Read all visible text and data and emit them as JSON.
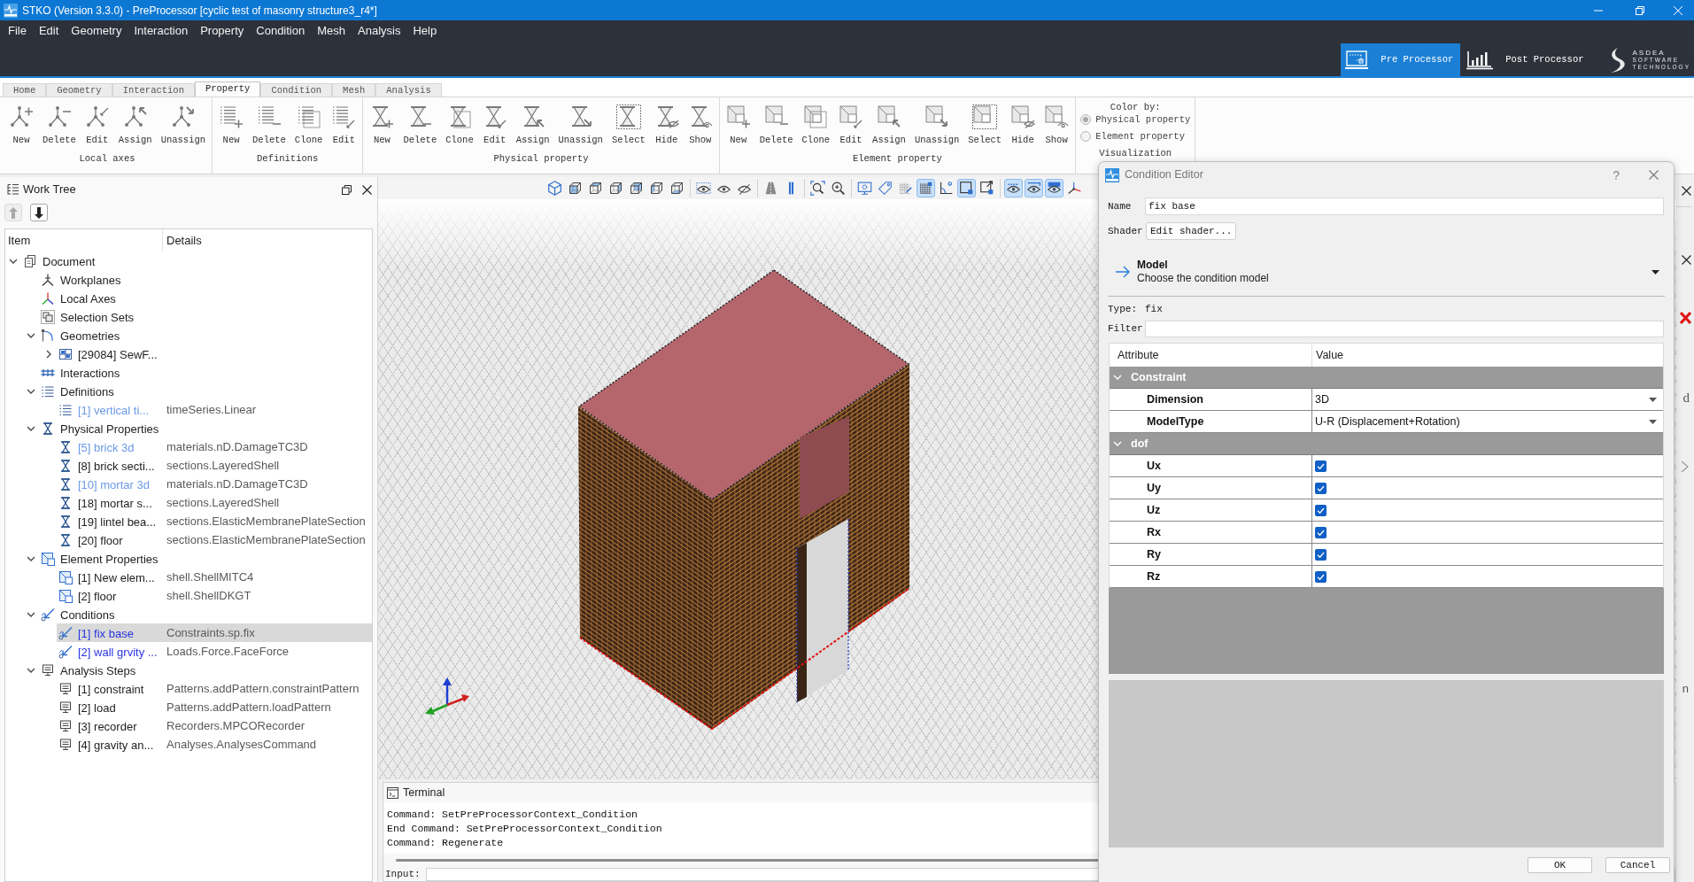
{
  "window": {
    "title": "STKO (Version 3.3.0) - PreProcessor [cyclic test of masonry structure3_r4*]"
  },
  "menu_bar": [
    "File",
    "Edit",
    "Geometry",
    "Interaction",
    "Property",
    "Condition",
    "Mesh",
    "Analysis",
    "Help"
  ],
  "modes": [
    {
      "label": "Pre Processor",
      "selected": true
    },
    {
      "label": "Post Processor",
      "selected": false
    }
  ],
  "logo": [
    "ASDEA",
    "SOFTWARE",
    "TECHNOLOGY"
  ],
  "ribbon": {
    "tabs": [
      {
        "label": "Home",
        "selected": false
      },
      {
        "label": "Geometry",
        "selected": false
      },
      {
        "label": "Interaction",
        "selected": false
      },
      {
        "label": "Property",
        "selected": true
      },
      {
        "label": "Condition",
        "selected": false
      },
      {
        "label": "Mesh",
        "selected": false
      },
      {
        "label": "Analysis",
        "selected": false
      }
    ],
    "groups": [
      {
        "label": "Local axes",
        "buttons": [
          "New",
          "Delete",
          "Edit",
          "Assign",
          "Unassign"
        ]
      },
      {
        "label": "Definitions",
        "buttons": [
          "New",
          "Delete",
          "Clone",
          "Edit"
        ]
      },
      {
        "label": "Physical property",
        "buttons": [
          "New",
          "Delete",
          "Clone",
          "Edit",
          "Assign",
          "Unassign",
          "Select",
          "Hide",
          "Show"
        ]
      },
      {
        "label": "Element property",
        "buttons": [
          "New",
          "Delete",
          "Clone",
          "Edit",
          "Assign",
          "Unassign",
          "Select",
          "Hide",
          "Show"
        ]
      }
    ],
    "visualization": {
      "heading": "Color by:",
      "options": [
        {
          "label": "Physical property",
          "selected": true
        },
        {
          "label": "Element property",
          "selected": false
        }
      ],
      "label": "Visualization"
    }
  },
  "work_tree": {
    "title": "Work Tree",
    "move_buttons": [
      {
        "disabled": true
      },
      {
        "disabled": false
      }
    ],
    "columns": [
      "Item",
      "Details"
    ],
    "items": [
      {
        "label": "Document",
        "expanded": true,
        "selected": false,
        "children": [
          {
            "label": "Workplanes",
            "selected": false
          },
          {
            "label": "Local Axes",
            "selected": false
          },
          {
            "label": "Selection Sets",
            "selected": false
          },
          {
            "label": "Geometries",
            "expanded": true,
            "selected": false,
            "children": [
              {
                "label": "[29084] SewF...",
                "expanded": false,
                "selected": false
              }
            ]
          },
          {
            "label": "Interactions",
            "selected": false
          },
          {
            "label": "Definitions",
            "expanded": true,
            "selected": false,
            "children": [
              {
                "label": "[1] vertical ti...",
                "details": "timeSeries.Linear",
                "color": "#6b9ae8",
                "selected": false
              }
            ]
          },
          {
            "label": "Physical Properties",
            "expanded": true,
            "selected": false,
            "children": [
              {
                "label": "[5] brick 3d",
                "details": "materials.nD.DamageTC3D",
                "color": "#6b9ae8",
                "selected": false
              },
              {
                "label": "[8] brick secti...",
                "details": "sections.LayeredShell",
                "color": "#1e1e1e",
                "selected": false
              },
              {
                "label": "[10] mortar 3d",
                "details": "materials.nD.DamageTC3D",
                "color": "#6b9ae8",
                "selected": false
              },
              {
                "label": "[18] mortar s...",
                "details": "sections.LayeredShell",
                "color": "#1e1e1e",
                "selected": false
              },
              {
                "label": "[19] lintel bea...",
                "details": "sections.ElasticMembranePlateSection",
                "color": "#1e1e1e",
                "selected": false
              },
              {
                "label": "[20] floor",
                "details": "sections.ElasticMembranePlateSection",
                "color": "#1e1e1e",
                "selected": false
              }
            ]
          },
          {
            "label": "Element Properties",
            "expanded": true,
            "selected": false,
            "children": [
              {
                "label": "[1] New elem...",
                "details": "shell.ShellMITC4",
                "color": "#1e1e1e",
                "selected": false
              },
              {
                "label": "[2] floor",
                "details": "shell.ShellDKGT",
                "color": "#1e1e1e",
                "selected": false
              }
            ]
          },
          {
            "label": "Conditions",
            "expanded": true,
            "selected": false,
            "children": [
              {
                "label": "[1] fix base",
                "details": "Constraints.sp.fix",
                "color": "#2a35e0",
                "selected": true
              },
              {
                "label": "[2] wall grvity ...",
                "details": "Loads.Force.FaceForce",
                "color": "#2a35e0",
                "selected": false
              }
            ]
          },
          {
            "label": "Analysis Steps",
            "expanded": true,
            "selected": false,
            "children": [
              {
                "label": "[1] constraint",
                "details": "Patterns.addPattern.constraintPattern",
                "color": "#1e1e1e",
                "selected": false
              },
              {
                "label": "[2] load",
                "details": "Patterns.addPattern.loadPattern",
                "color": "#1e1e1e",
                "selected": false
              },
              {
                "label": "[3] recorder",
                "details": "Recorders.MPCORecorder",
                "color": "#1e1e1e",
                "selected": false
              },
              {
                "label": "[4] gravity an...",
                "details": "Analyses.AnalysesCommand",
                "color": "#1e1e1e",
                "selected": false
              }
            ]
          }
        ]
      }
    ]
  },
  "viewport": {
    "toolbar": [
      {
        "selected": false
      },
      {
        "selected": false
      },
      {
        "selected": false
      },
      {
        "selected": false
      },
      {
        "selected": false
      },
      {
        "selected": false
      },
      {
        "selected": false
      },
      {
        "selected": false
      },
      {
        "selected": false
      },
      {
        "selected": false
      },
      {
        "selected": false
      },
      {
        "selected": false
      },
      {
        "selected": false
      },
      {
        "selected": false
      },
      {
        "selected": false
      },
      {
        "selected": false
      },
      {
        "selected": false
      },
      {
        "selected": true
      },
      {
        "selected": false
      },
      {
        "selected": true
      },
      {
        "selected": false
      },
      {
        "selected": true
      },
      {
        "selected": true
      },
      {
        "selected": true
      },
      {
        "selected": false
      }
    ]
  },
  "terminal": {
    "title": "Terminal",
    "lines": [
      "Command: SetPreProcessorContext_Condition",
      "End Command: SetPreProcessorContext_Condition",
      "Command: Regenerate"
    ],
    "input_label": "Input:"
  },
  "condition_editor": {
    "title": "Condition Editor",
    "help_button": "?",
    "name_label": "Name",
    "name_value": "fix base",
    "shader_label": "Shader",
    "shader_button": "Edit shader...",
    "model": {
      "title": "Model",
      "subtitle": "Choose the condition model"
    },
    "type_label": "Type:",
    "type_value": "fix",
    "filter_label": "Filter",
    "table": {
      "columns": [
        "Attribute",
        "Value"
      ],
      "groups": [
        {
          "label": "Constraint",
          "expanded": true,
          "rows": [
            {
              "kind": "dropdown",
              "label": "Dimension",
              "value": "3D"
            },
            {
              "kind": "dropdown",
              "label": "ModelType",
              "value": "U-R (Displacement+Rotation)"
            }
          ]
        },
        {
          "label": "dof",
          "expanded": true,
          "rows": [
            {
              "kind": "checkbox",
              "label": "Ux",
              "checked": true
            },
            {
              "kind": "checkbox",
              "label": "Uy",
              "checked": true
            },
            {
              "kind": "checkbox",
              "label": "Uz",
              "checked": true
            },
            {
              "kind": "checkbox",
              "label": "Rx",
              "checked": true
            },
            {
              "kind": "checkbox",
              "label": "Ry",
              "checked": true
            },
            {
              "kind": "checkbox",
              "label": "Rz",
              "checked": true
            }
          ]
        }
      ]
    },
    "buttons": [
      "OK",
      "Cancel"
    ]
  },
  "side_panel": {
    "text_1": "d",
    "text_2": "n"
  }
}
